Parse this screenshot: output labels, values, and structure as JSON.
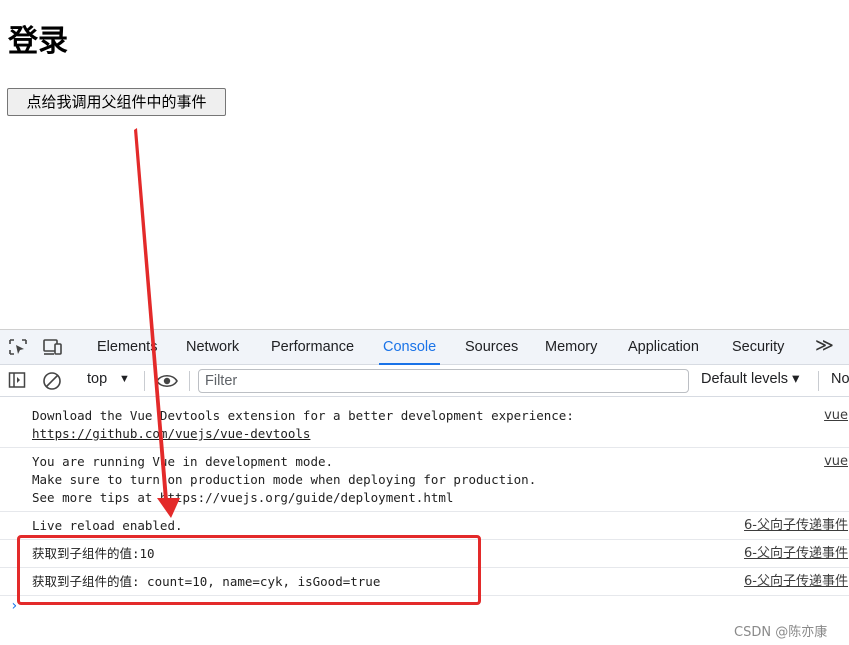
{
  "page": {
    "title": "登录",
    "button_label": "点给我调用父组件中的事件"
  },
  "devtools": {
    "tabs": [
      {
        "label": "Elements",
        "active": false
      },
      {
        "label": "Network",
        "active": false
      },
      {
        "label": "Performance",
        "active": false
      },
      {
        "label": "Console",
        "active": true
      },
      {
        "label": "Sources",
        "active": false
      },
      {
        "label": "Memory",
        "active": false
      },
      {
        "label": "Application",
        "active": false
      },
      {
        "label": "Security",
        "active": false
      }
    ],
    "more_tabs": "≫",
    "toolbar": {
      "context": "top",
      "filter_placeholder": "Filter",
      "levels": "Default levels ▾",
      "issues": "No"
    },
    "messages": [
      {
        "lines": [
          "Download the Vue Devtools extension for a better development experience:",
          "https://github.com/vuejs/vue-devtools"
        ],
        "source": "vue"
      },
      {
        "lines": [
          "You are running Vue in development mode.",
          "Make sure to turn on production mode when deploying for production.",
          "See more tips at https://vuejs.org/guide/deployment.html"
        ],
        "source": "vue"
      },
      {
        "lines": [
          "Live reload enabled."
        ],
        "source": "6-父向子传递事件"
      },
      {
        "lines": [
          "获取到子组件的值:10"
        ],
        "source": "6-父向子传递事件"
      },
      {
        "lines": [
          "获取到子组件的值: count=10, name=cyk, isGood=true"
        ],
        "source": "6-父向子传递事件"
      }
    ],
    "prompt": "›"
  },
  "annotation": {
    "color": "#e32a2a"
  },
  "watermark": "CSDN @陈亦康"
}
